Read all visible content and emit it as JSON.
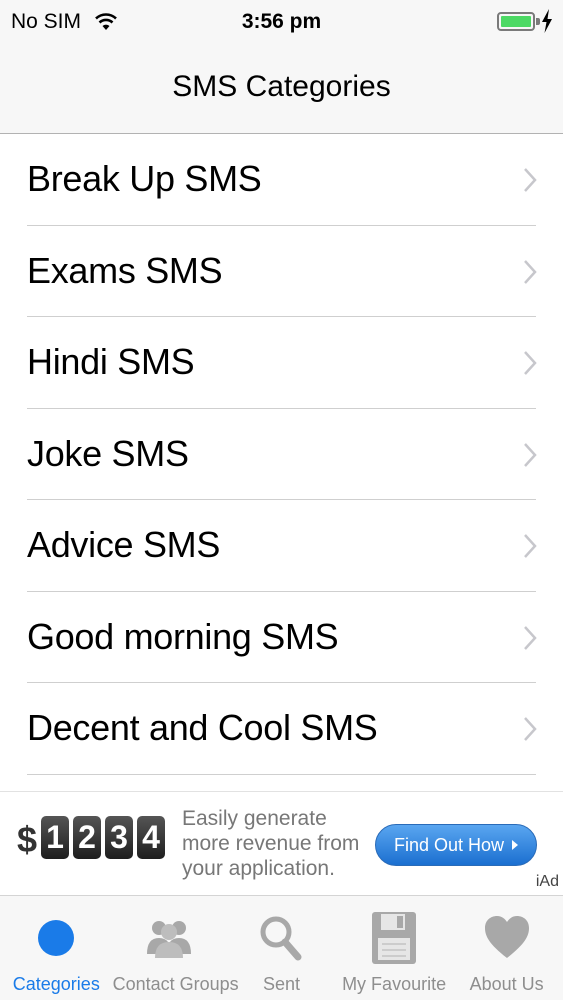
{
  "status_bar": {
    "carrier": "No SIM",
    "time": "3:56 pm"
  },
  "nav": {
    "title": "SMS Categories"
  },
  "categories": [
    {
      "label": "Break Up SMS"
    },
    {
      "label": "Exams SMS"
    },
    {
      "label": "Hindi SMS"
    },
    {
      "label": "Joke SMS"
    },
    {
      "label": "Advice SMS"
    },
    {
      "label": "Good morning SMS"
    },
    {
      "label": "Decent and Cool SMS"
    }
  ],
  "ad": {
    "dollar": "$",
    "digits": [
      "1",
      "2",
      "3",
      "4"
    ],
    "line1": "Easily generate",
    "line2": "more revenue from",
    "line3": "your application.",
    "button": "Find Out How",
    "badge": "iAd"
  },
  "tabs": [
    {
      "label": "Categories",
      "icon": "circle-icon",
      "active": true
    },
    {
      "label": "Contact Groups",
      "icon": "people-icon",
      "active": false
    },
    {
      "label": "Sent",
      "icon": "magnifier-icon",
      "active": false
    },
    {
      "label": "My Favourite",
      "icon": "floppy-disk-icon",
      "active": false
    },
    {
      "label": "About  Us",
      "icon": "heart-icon",
      "active": false
    }
  ],
  "colors": {
    "accent": "#1a7be8",
    "battery": "#4cd964",
    "tab_inactive": "#8e8e8e"
  }
}
